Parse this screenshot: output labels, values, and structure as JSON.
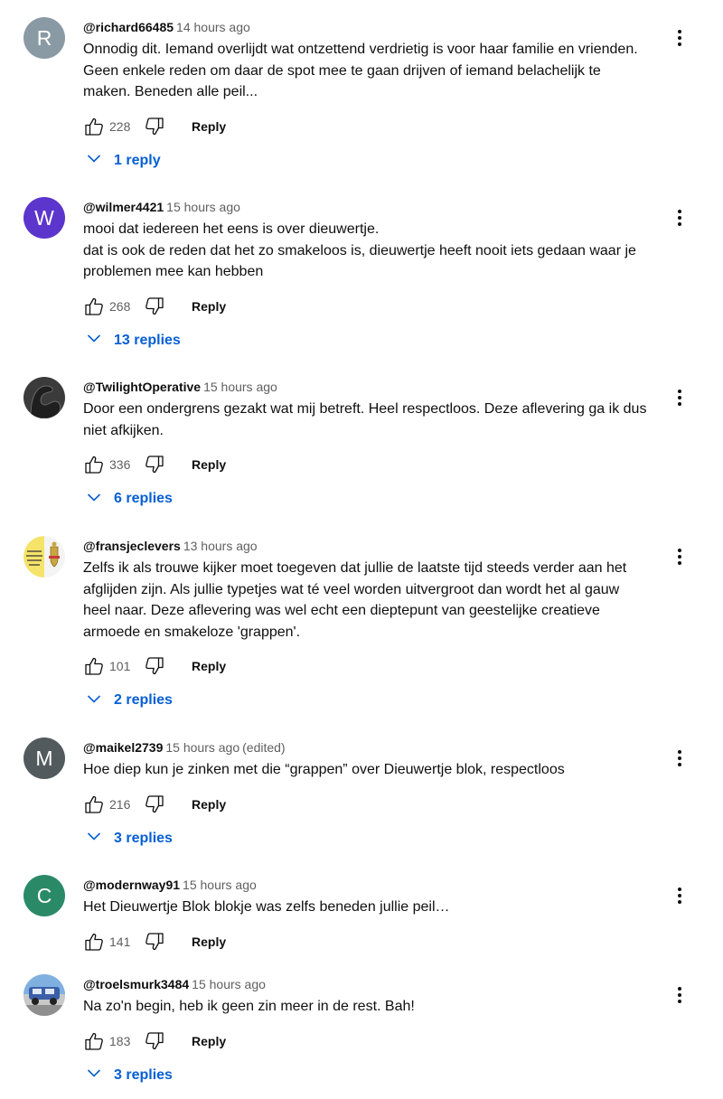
{
  "reply_label": "Reply",
  "icons": {
    "like": "thumbs-up-icon",
    "dislike": "thumbs-down-icon",
    "more": "more-vert-icon",
    "expand": "chevron-down-icon"
  },
  "colors": {
    "link_blue": "#065fd4",
    "secondary_text": "#606060"
  },
  "comments": [
    {
      "author": "@richard66485",
      "time": "14 hours ago",
      "text": "Onnodig dit. Iemand overlijdt wat ontzettend verdrietig is voor haar familie en vrienden.\nGeen enkele reden om daar de spot mee te gaan drijven of iemand belachelijk te\nmaken. Beneden alle peil...",
      "likes": "228",
      "replies": "1 reply",
      "avatar_letter": "R",
      "avatar_color": "#8a9aa4"
    },
    {
      "author": "@wilmer4421",
      "time": "15 hours ago",
      "text": "mooi dat iedereen het eens is over dieuwertje.\ndat is ook de reden dat het zo smakeloos is, dieuwertje heeft nooit iets gedaan waar je\nproblemen mee kan hebben",
      "likes": "268",
      "replies": "13 replies",
      "avatar_letter": "W",
      "avatar_color": "#5c35cc"
    },
    {
      "author": "@TwilightOperative",
      "time": "15 hours ago",
      "text": "Door een ondergrens gezakt wat mij betreft. Heel respectloos. Deze aflevering ga ik dus\nniet afkijken.",
      "likes": "336",
      "replies": "6 replies",
      "avatar_letter": "",
      "avatar_color": "#3b3b3b"
    },
    {
      "author": "@fransjeclevers",
      "time": "13 hours ago",
      "text": "Zelfs ik als trouwe kijker moet toegeven dat jullie de laatste tijd steeds verder aan het\nafglijden zijn. Als jullie typetjes wat té veel worden uitvergroot dan wordt het al gauw\nheel naar. Deze aflevering was wel echt een dieptepunt van geestelijke creatieve\narmoede en smakeloze 'grappen'.",
      "likes": "101",
      "replies": "2 replies",
      "avatar_letter": "",
      "avatar_color": "#f5e36a"
    },
    {
      "author": "@maikel2739",
      "time": "15 hours ago",
      "edited": "(edited)",
      "text": "Hoe diep kun je zinken met die “grappen” over Dieuwertje blok, respectloos",
      "likes": "216",
      "replies": "3 replies",
      "avatar_letter": "M",
      "avatar_color": "#525a5e"
    },
    {
      "author": "@modernway91",
      "time": "15 hours ago",
      "text": "Het Dieuwertje Blok blokje was zelfs beneden jullie peil…",
      "likes": "141",
      "replies": "",
      "avatar_letter": "C",
      "avatar_color": "#2a8a68"
    },
    {
      "author": "@troelsmurk3484",
      "time": "15 hours ago",
      "text": "Na zo'n begin, heb ik geen zin meer in de rest. Bah!",
      "likes": "183",
      "replies": "3 replies",
      "avatar_letter": "",
      "avatar_color": "#9bbfe0"
    }
  ]
}
